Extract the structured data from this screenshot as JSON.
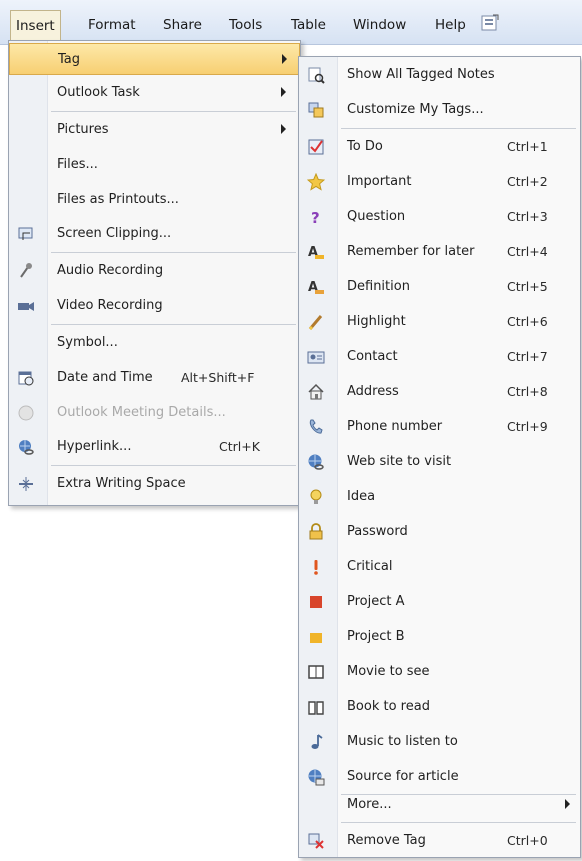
{
  "menubar": {
    "items": [
      "Insert",
      "Format",
      "Share",
      "Tools",
      "Table",
      "Window",
      "Help"
    ],
    "active": "Insert"
  },
  "insert_menu": {
    "items": [
      {
        "label": "Tag",
        "shortcut": "",
        "submenu": true,
        "icon": "",
        "highlighted": true
      },
      {
        "label": "Outlook Task",
        "shortcut": "",
        "submenu": true,
        "icon": ""
      },
      {
        "label": "Pictures",
        "shortcut": "",
        "submenu": true,
        "icon": ""
      },
      {
        "label": "Files...",
        "shortcut": "",
        "icon": ""
      },
      {
        "label": "Files as Printouts...",
        "shortcut": "",
        "icon": ""
      },
      {
        "label": "Screen Clipping...",
        "shortcut": "",
        "icon": "screen-clipping-icon"
      },
      {
        "label": "Audio Recording",
        "shortcut": "",
        "icon": "audio-recording-icon"
      },
      {
        "label": "Video Recording",
        "shortcut": "",
        "icon": "video-recording-icon"
      },
      {
        "label": "Symbol...",
        "shortcut": "",
        "icon": ""
      },
      {
        "label": "Date and Time",
        "shortcut": "Alt+Shift+F",
        "icon": "date-time-icon"
      },
      {
        "label": "Outlook Meeting Details...",
        "shortcut": "",
        "icon": "meeting-details-icon",
        "disabled": true
      },
      {
        "label": "Hyperlink...",
        "shortcut": "Ctrl+K",
        "icon": "hyperlink-icon"
      },
      {
        "label": "Extra Writing Space",
        "shortcut": "",
        "icon": "extra-space-icon"
      }
    ]
  },
  "tag_submenu": {
    "items": [
      {
        "label": "Show All Tagged Notes",
        "shortcut": "",
        "icon": "show-tagged-icon"
      },
      {
        "label": "Customize My Tags...",
        "shortcut": "",
        "icon": "customize-tags-icon"
      },
      {
        "label": "To Do",
        "shortcut": "Ctrl+1",
        "icon": "todo-checkbox-icon"
      },
      {
        "label": "Important",
        "shortcut": "Ctrl+2",
        "icon": "star-icon"
      },
      {
        "label": "Question",
        "shortcut": "Ctrl+3",
        "icon": "question-icon"
      },
      {
        "label": "Remember for later",
        "shortcut": "Ctrl+4",
        "icon": "highlighter-a-yellow-icon"
      },
      {
        "label": "Definition",
        "shortcut": "Ctrl+5",
        "icon": "highlighter-a-green-icon"
      },
      {
        "label": "Highlight",
        "shortcut": "Ctrl+6",
        "icon": "highlight-pen-icon"
      },
      {
        "label": "Contact",
        "shortcut": "Ctrl+7",
        "icon": "contact-card-icon"
      },
      {
        "label": "Address",
        "shortcut": "Ctrl+8",
        "icon": "house-icon"
      },
      {
        "label": "Phone number",
        "shortcut": "Ctrl+9",
        "icon": "phone-icon"
      },
      {
        "label": "Web site to visit",
        "shortcut": "",
        "icon": "globe-icon"
      },
      {
        "label": "Idea",
        "shortcut": "",
        "icon": "lightbulb-icon"
      },
      {
        "label": "Password",
        "shortcut": "",
        "icon": "lock-icon"
      },
      {
        "label": "Critical",
        "shortcut": "",
        "icon": "exclamation-icon"
      },
      {
        "label": "Project A",
        "shortcut": "",
        "icon": "project-a-icon"
      },
      {
        "label": "Project B",
        "shortcut": "",
        "icon": "project-b-icon"
      },
      {
        "label": "Movie to see",
        "shortcut": "",
        "icon": "movie-icon"
      },
      {
        "label": "Book to read",
        "shortcut": "",
        "icon": "book-icon"
      },
      {
        "label": "Music to listen to",
        "shortcut": "",
        "icon": "music-note-icon"
      },
      {
        "label": "Source for article",
        "shortcut": "",
        "icon": "source-globe-icon"
      },
      {
        "label": "More...",
        "shortcut": "",
        "submenu": true,
        "icon": ""
      },
      {
        "label": "Remove Tag",
        "shortcut": "Ctrl+0",
        "icon": "remove-tag-icon"
      }
    ]
  }
}
